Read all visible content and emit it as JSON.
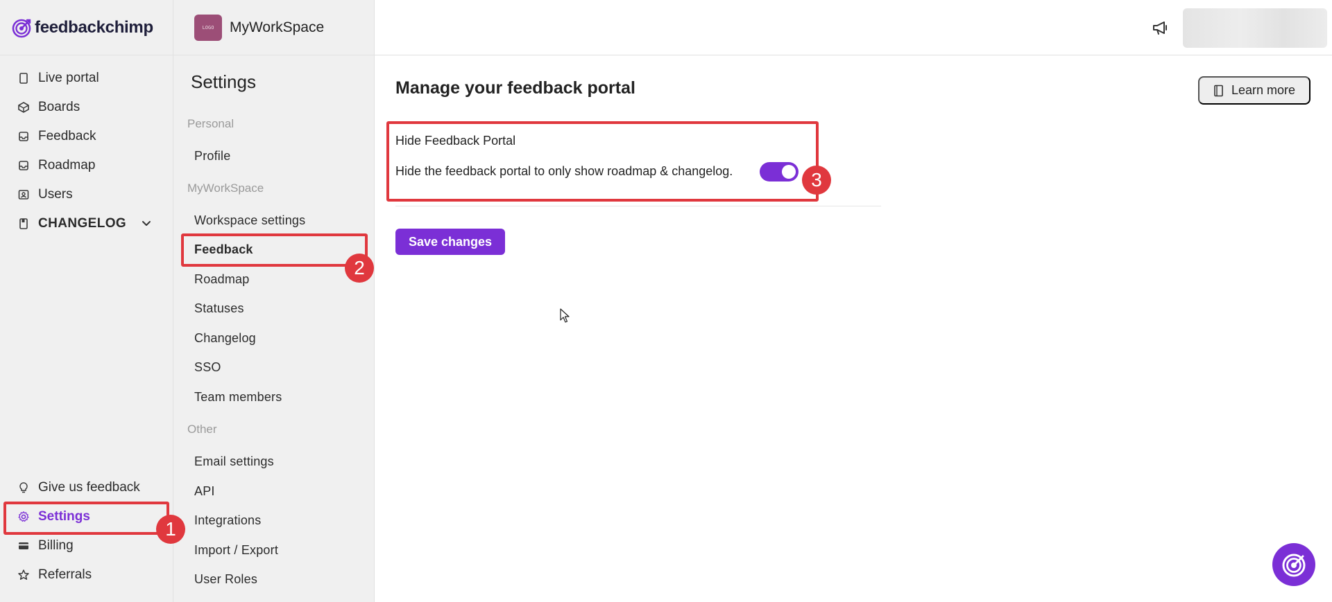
{
  "brand": {
    "name": "feedbackchimp",
    "accent": "#7b2fd6"
  },
  "nav": {
    "items": [
      {
        "label": "Live portal",
        "icon": "document-icon"
      },
      {
        "label": "Boards",
        "icon": "boards-icon"
      },
      {
        "label": "Feedback",
        "icon": "inbox-icon"
      },
      {
        "label": "Roadmap",
        "icon": "roadmap-icon"
      },
      {
        "label": "Users",
        "icon": "users-icon"
      },
      {
        "label": "CHANGELOG",
        "icon": "changelog-icon"
      }
    ],
    "bottom": [
      {
        "label": "Give us feedback",
        "icon": "lightbulb-icon"
      },
      {
        "label": "Settings",
        "icon": "gear-icon"
      },
      {
        "label": "Billing",
        "icon": "card-icon"
      },
      {
        "label": "Referrals",
        "icon": "star-icon"
      }
    ]
  },
  "workspace": {
    "name": "MyWorkSpace",
    "logo_text": "LOGO"
  },
  "settings": {
    "title": "Settings",
    "personal_label": "Personal",
    "personal_items": [
      "Profile"
    ],
    "workspace_label": "MyWorkSpace",
    "workspace_items": [
      "Workspace settings",
      "Feedback",
      "Roadmap",
      "Statuses",
      "Changelog",
      "SSO",
      "Team members"
    ],
    "other_label": "Other",
    "other_items": [
      "Email settings",
      "API",
      "Integrations",
      "Import / Export",
      "User Roles"
    ]
  },
  "main": {
    "title": "Manage your feedback portal",
    "learn_more": "Learn more",
    "option_title": "Hide Feedback Portal",
    "option_desc": "Hide the feedback portal to only show roadmap & changelog.",
    "toggle_on": true,
    "save_label": "Save changes"
  },
  "annotations": {
    "badge1": "1",
    "badge2": "2",
    "badge3": "3",
    "color": "#e0383e"
  }
}
